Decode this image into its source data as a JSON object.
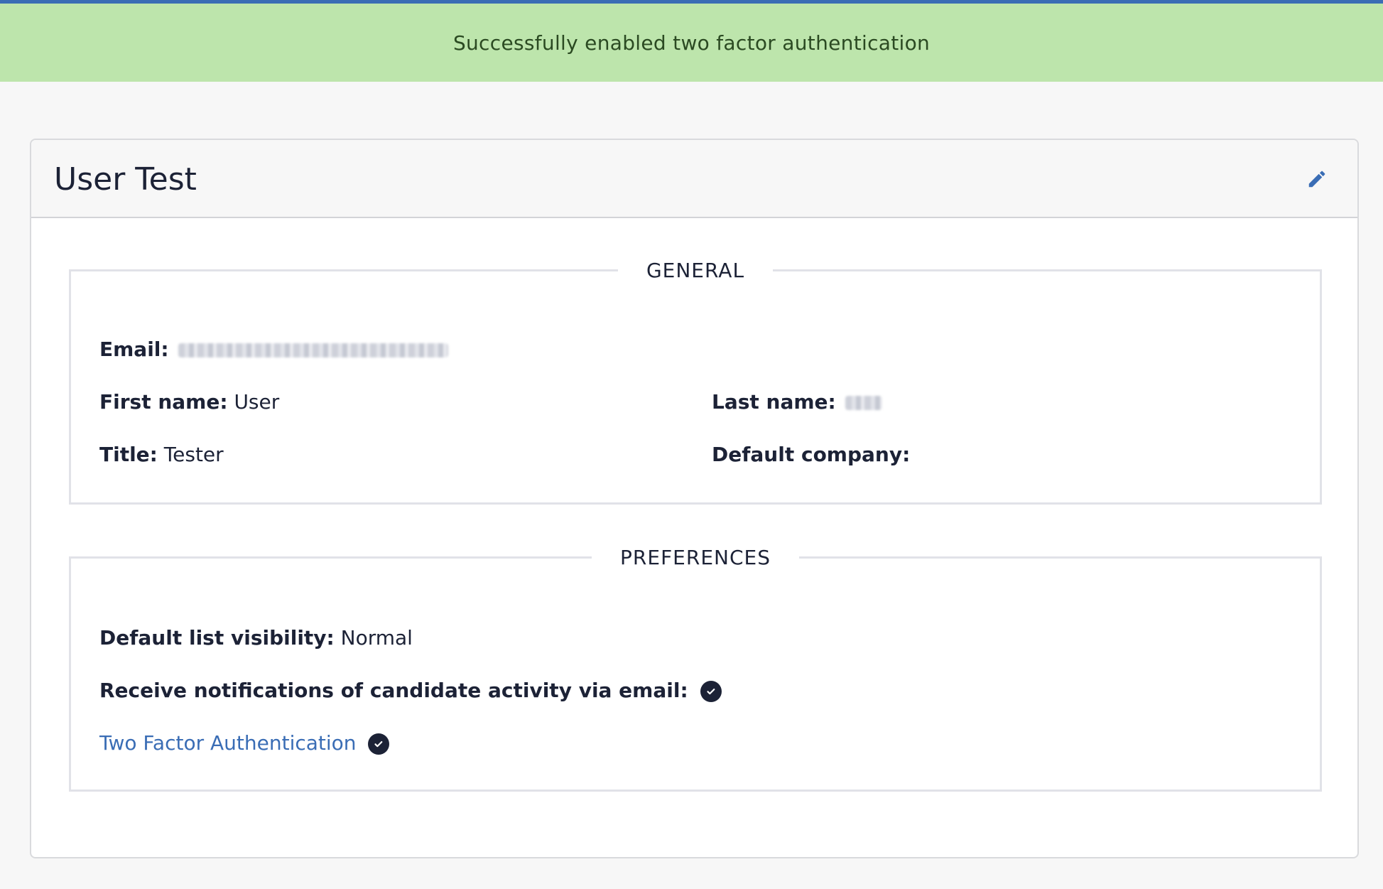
{
  "flash": {
    "message": "Successfully enabled two factor authentication"
  },
  "header": {
    "title": "User Test",
    "edit_icon": "pencil-icon"
  },
  "general": {
    "legend": "GENERAL",
    "email_label": "Email:",
    "first_name_label": "First name:",
    "first_name_value": "User",
    "last_name_label": "Last name:",
    "title_label": "Title:",
    "title_value": "Tester",
    "default_company_label": "Default company:"
  },
  "preferences": {
    "legend": "PREFERENCES",
    "list_visibility_label": "Default list visibility:",
    "list_visibility_value": "Normal",
    "notifications_label": "Receive notifications of candidate activity via email:",
    "two_factor_link": "Two Factor Authentication",
    "check_icon": "check-circle-icon"
  },
  "colors": {
    "accent": "#3a6db5",
    "flash_bg": "#bde5ac",
    "text": "#1c2236"
  }
}
